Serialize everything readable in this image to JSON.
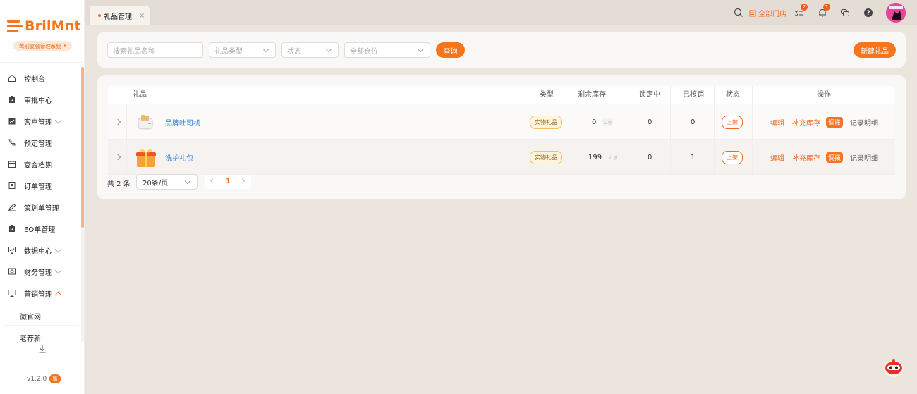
{
  "brand": {
    "name": "BrilMnt",
    "system_label": "莺别宴会管理系统",
    "accent": "#f4751e"
  },
  "sidebar": {
    "items": [
      {
        "label": "控制台",
        "icon": "home-icon"
      },
      {
        "label": "审批中心",
        "icon": "clipboard-icon"
      },
      {
        "label": "客户管理",
        "icon": "chart-icon",
        "expandable": true
      },
      {
        "label": "预定管理",
        "icon": "phone-icon"
      },
      {
        "label": "宴会档期",
        "icon": "calendar-icon"
      },
      {
        "label": "订单管理",
        "icon": "document-icon"
      },
      {
        "label": "策划单管理",
        "icon": "pen-icon"
      },
      {
        "label": "EO单管理",
        "icon": "checklist-icon"
      },
      {
        "label": "数据中心",
        "icon": "analytics-icon",
        "expandable": true
      },
      {
        "label": "财务管理",
        "icon": "finance-icon",
        "expandable": true
      },
      {
        "label": "营销管理",
        "icon": "monitor-icon",
        "expanded": true
      }
    ],
    "sub_items": [
      "微官网",
      "老荐新"
    ],
    "version": "v1.2.0",
    "new_badge": "新"
  },
  "tabs": [
    {
      "label": "礼品管理",
      "close": "×",
      "active": true
    }
  ],
  "topbar": {
    "store_label": "全部门店",
    "todo_badge": "2",
    "bell_badge": "1"
  },
  "filters": {
    "search_placeholder": "搜索礼品名称",
    "type_placeholder": "礼品类型",
    "status_placeholder": "状态",
    "warehouse_placeholder": "全部仓位",
    "query_button": "查询",
    "new_button": "新建礼品"
  },
  "table": {
    "headers": [
      "礼品",
      "类型",
      "剩余库存",
      "锁定中",
      "已核销",
      "状态",
      "操作"
    ],
    "rows": [
      {
        "name": "品牌吐司机",
        "type": "实物礼品",
        "stock": "0",
        "stock_tag": "汇总",
        "locked": "0",
        "redeemed": "0",
        "status": "上架"
      },
      {
        "name": "洗护礼包",
        "type": "实物礼品",
        "stock": "199",
        "stock_tag": "汇总",
        "locked": "0",
        "redeemed": "1",
        "status": "上架"
      }
    ],
    "actions": {
      "edit": "编辑",
      "restock": "补充库存",
      "transfer": "调拨",
      "records": "记录明细"
    }
  },
  "pagination": {
    "total": "共 2 条",
    "page_size": "20条/页",
    "current": "1"
  }
}
